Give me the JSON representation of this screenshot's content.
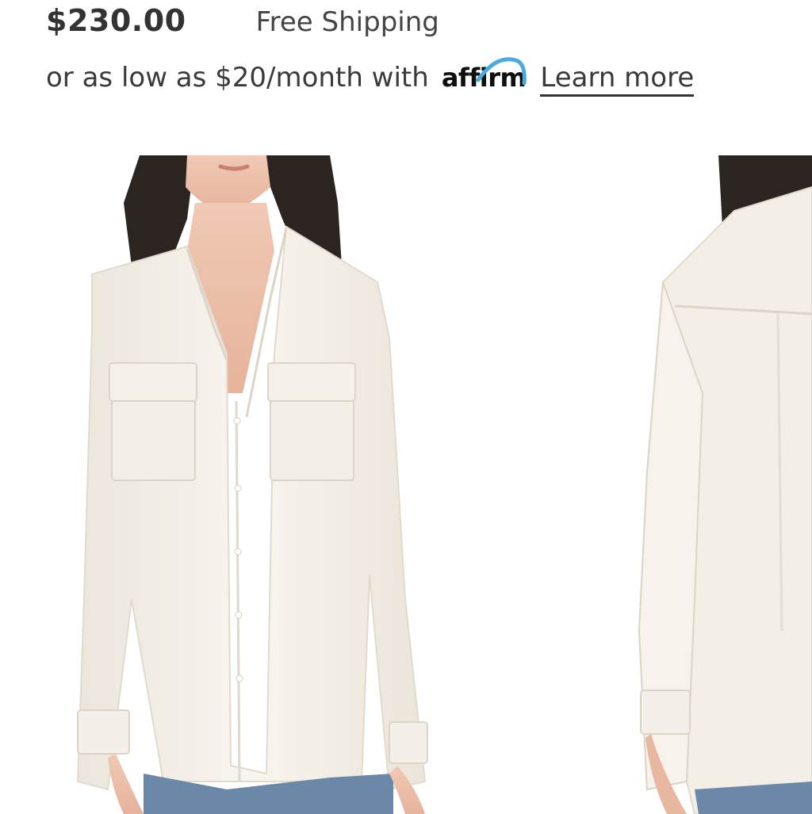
{
  "product": {
    "price": "$230.00",
    "shipping": "Free Shipping"
  },
  "financing": {
    "prefix": "or as low as $20/month with",
    "provider_logo_text": "affirm",
    "learn_more": "Learn more"
  },
  "gallery": {
    "images": [
      {
        "view": "front",
        "icon": "blouse-front-photo"
      },
      {
        "view": "back",
        "icon": "blouse-back-photo"
      }
    ]
  },
  "colors": {
    "affirm_arc": "#4aa9e0",
    "text": "#333333",
    "background": "#ffffff",
    "blouse": "#f6f2ea"
  }
}
